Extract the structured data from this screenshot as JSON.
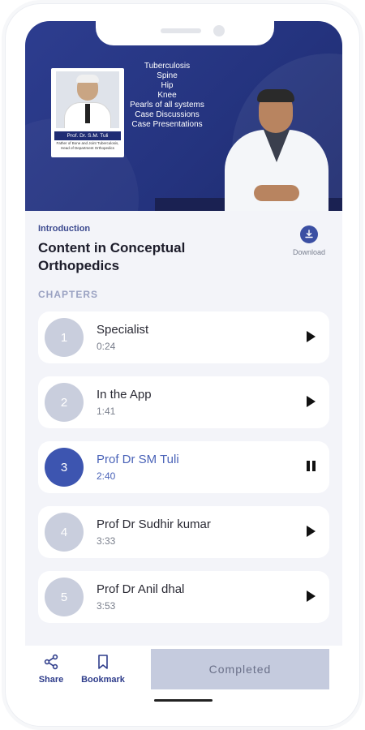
{
  "video": {
    "topics": [
      "Tuberculosis",
      "Spine",
      "Hip",
      "Knee",
      "Pearls of all systems",
      "Case Discussions",
      "Case Presentations"
    ],
    "card_name": "Prof. Dr. S.M. Tuli",
    "card_sub": "Father of Bone and Joint Tuberculosis, Head of Department Orthopedics"
  },
  "lesson": {
    "section_label": "Introduction",
    "title": "Content in Conceptual Orthopedics",
    "download_label": "Download"
  },
  "chapters_heading": "CHAPTERS",
  "chapters": [
    {
      "number": "1",
      "name": "Specialist",
      "duration": "0:24",
      "state": "play"
    },
    {
      "number": "2",
      "name": "In the App",
      "duration": "1:41",
      "state": "play"
    },
    {
      "number": "3",
      "name": "Prof Dr SM Tuli",
      "duration": "2:40",
      "state": "pause"
    },
    {
      "number": "4",
      "name": "Prof Dr Sudhir kumar",
      "duration": "3:33",
      "state": "play"
    },
    {
      "number": "5",
      "name": "Prof Dr Anil dhal",
      "duration": "3:53",
      "state": "play"
    }
  ],
  "bottom_bar": {
    "share_label": "Share",
    "bookmark_label": "Bookmark",
    "completed_label": "Completed"
  },
  "colors": {
    "accent": "#3d55b0",
    "video_bg": "#2d3d8f",
    "inactive_number": "#c9cedd",
    "completed_bg": "#c5cbde"
  }
}
